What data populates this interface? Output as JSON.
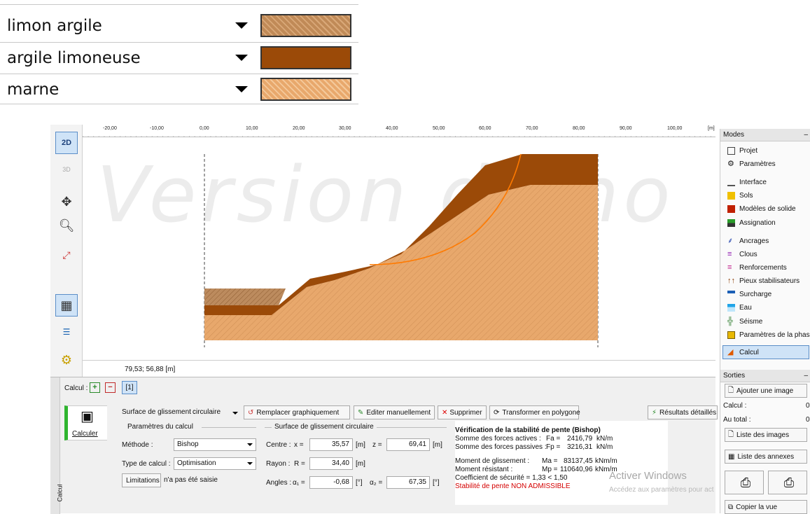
{
  "legend": [
    {
      "label": "limon argile",
      "fill": "#c08a57",
      "pattern": "hatch"
    },
    {
      "label": "argile limoneuse",
      "fill": "#9b4a08",
      "pattern": "solid"
    },
    {
      "label": "marne",
      "fill": "#e8a86c",
      "pattern": "hatch"
    }
  ],
  "toolbar": {
    "btn_2d": "2D",
    "btn_3d": "3D"
  },
  "canvas": {
    "watermark": "Version démo",
    "ruler_ticks": [
      "-20,00",
      "-10,00",
      "0,00",
      "10,00",
      "20,00",
      "30,00",
      "40,00",
      "50,00",
      "60,00",
      "70,00",
      "80,00",
      "90,00",
      "100,00"
    ],
    "ruler_unit": "[m]",
    "coords": "79,53; 56,88 [m]"
  },
  "modes": {
    "title": "Modes",
    "items": [
      "Projet",
      "Paramètres",
      "Interface",
      "Sols",
      "Modèles de solide",
      "Assignation",
      "Ancrages",
      "Clous",
      "Renforcements",
      "Pieux stabilisateurs",
      "Surcharge",
      "Eau",
      "Séisme",
      "Paramètres de la phase",
      "Calcul"
    ]
  },
  "sorties": {
    "title": "Sorties",
    "add_image": "Ajouter une image",
    "calcul_label": "Calcul :",
    "calcul_value": "0",
    "total_label": "Au total :",
    "total_value": "0",
    "list_images": "Liste des images",
    "list_annexes": "Liste des annexes",
    "copy_view": "Copier la vue"
  },
  "bottom": {
    "side_tab": "Calcul",
    "calcul_label": "Calcul :",
    "stage_tab": "[1]",
    "calculer": "Calculer",
    "surface_label": "Surface de glissement :",
    "surface_value": "circulaire",
    "replace_graphic": "Remplacer graphiquement",
    "edit_manual": "Editer manuellement",
    "delete": "Supprimer",
    "transform_polygon": "Transformer en polygone",
    "detailed_results": "Résultats détaillés",
    "params_group": "Paramètres du calcul",
    "method_label": "Méthode :",
    "method_value": "Bishop",
    "calc_type_label": "Type de calcul :",
    "calc_type_value": "Optimisation",
    "limitations_btn": "Limitations",
    "limitations_text": "n'a pas été saisie",
    "circle_group": "Surface de glissement circulaire",
    "centre_label": "Centre :",
    "x_label": "x =",
    "x_value": "35,57",
    "z_label": "z =",
    "z_value": "69,41",
    "unit_m": "[m]",
    "rayon_label": "Rayon :",
    "r_label": "R =",
    "r_value": "34,40",
    "angles_label": "Angles :",
    "a1_label": "α₁ =",
    "a1_value": "-0,68",
    "a2_label": "α₂ =",
    "a2_value": "67,35",
    "unit_deg": "[°]"
  },
  "results": {
    "title": "Vérification de la stabilité de pente (Bishop)",
    "active_label": "Somme des forces actives :",
    "active_sym": "Fa =",
    "active_value": "2416,79",
    "force_unit": "kN/m",
    "passive_label": "Somme des forces passives :",
    "passive_sym": "Fp =",
    "passive_value": "3216,31",
    "slide_label": "Moment de glissement :",
    "slide_sym": "Ma =",
    "slide_value": "83137,45",
    "moment_unit": "kNm/m",
    "resist_label": "Moment résistant :",
    "resist_sym": "Mp =",
    "resist_value": "110640,96",
    "safety": "Coefficient de sécurité = 1,33 < 1,50",
    "verdict": "Stabilité de pente NON ADMISSIBLE"
  },
  "os_watermark": {
    "line1": "Activer Windows",
    "line2": "Accédez aux paramètres pour activer Windows."
  },
  "colors": {
    "marne": "#e8a86c",
    "argile": "#9b4a08",
    "limon": "#c08a57",
    "slip_circle": "#ff7a00",
    "error": "#d40000",
    "active_bar": "#2fb52f"
  }
}
